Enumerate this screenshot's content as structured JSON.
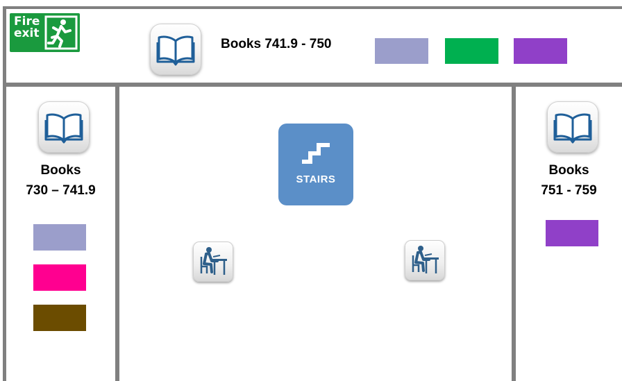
{
  "map": {
    "fire_exit": {
      "line1": "Fire",
      "line2": "exit",
      "icon": "running-man-exit-icon"
    },
    "top_section": {
      "label": "Books 741.9 - 750",
      "icon": "open-book-icon",
      "swatches": [
        "#9b9ecb",
        "#00b050",
        "#9040c8"
      ]
    },
    "left_section": {
      "label_line1": "Books",
      "label_line2": "730 – 741.9",
      "icon": "open-book-icon",
      "swatches": [
        "#9b9ecb",
        "#ff0090",
        "#6b4c00"
      ]
    },
    "right_section": {
      "label_line1": "Books",
      "label_line2": "751 - 759",
      "icon": "open-book-icon",
      "swatches": [
        "#9040c8"
      ]
    },
    "stairs": {
      "label": "STAIRS",
      "icon": "stairs-icon",
      "color": "#5b8fc8"
    },
    "study_desks": [
      {
        "icon": "study-desk-icon"
      },
      {
        "icon": "study-desk-icon"
      }
    ],
    "colors": {
      "walls": "#808080",
      "fire_exit_green": "#1a9a3e"
    }
  }
}
